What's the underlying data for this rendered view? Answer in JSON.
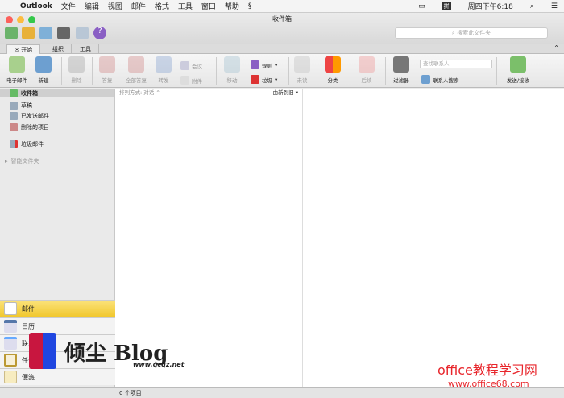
{
  "menubar": {
    "app": "Outlook",
    "items": [
      "文件",
      "编辑",
      "视图",
      "邮件",
      "格式",
      "工具",
      "窗口",
      "帮助"
    ],
    "clock": "周四下午6:18",
    "ime": "拼"
  },
  "window": {
    "title": "收件箱",
    "search_placeholder": "搜索此文件夹"
  },
  "tabs": [
    "开始",
    "组织",
    "工具"
  ],
  "ribbon": {
    "email": "电子邮件",
    "new": "新建",
    "delete": "删除",
    "reply": "答复",
    "reply_all": "全部答复",
    "forward": "转发",
    "meeting": "会议",
    "attachment": "附件",
    "move": "移动",
    "rules": "规则",
    "junk": "垃圾",
    "unread": "未读",
    "categorize": "分类",
    "follow_up": "后续",
    "filter": "过滤器",
    "find_contact_placeholder": "查找联系人",
    "contact_search": "联系人搜索",
    "send_receive": "发送/接收"
  },
  "folders": {
    "inbox": "收件箱",
    "drafts": "草稿",
    "sent": "已发送邮件",
    "deleted": "删除的项目",
    "junk": "垃圾邮件",
    "smart": "智能文件夹"
  },
  "list": {
    "sort": "排列方式: 对话 ⌃",
    "order": "由新到旧 ▾"
  },
  "nav": [
    "邮件",
    "日历",
    "联系人",
    "任务",
    "便笺"
  ],
  "status": {
    "count": "0 个项目"
  },
  "watermark": {
    "blog": "倾尘 Blog",
    "blog_url": "www.qcqz.net",
    "site": "office教程学习网",
    "site_url": "www.office68.com"
  }
}
